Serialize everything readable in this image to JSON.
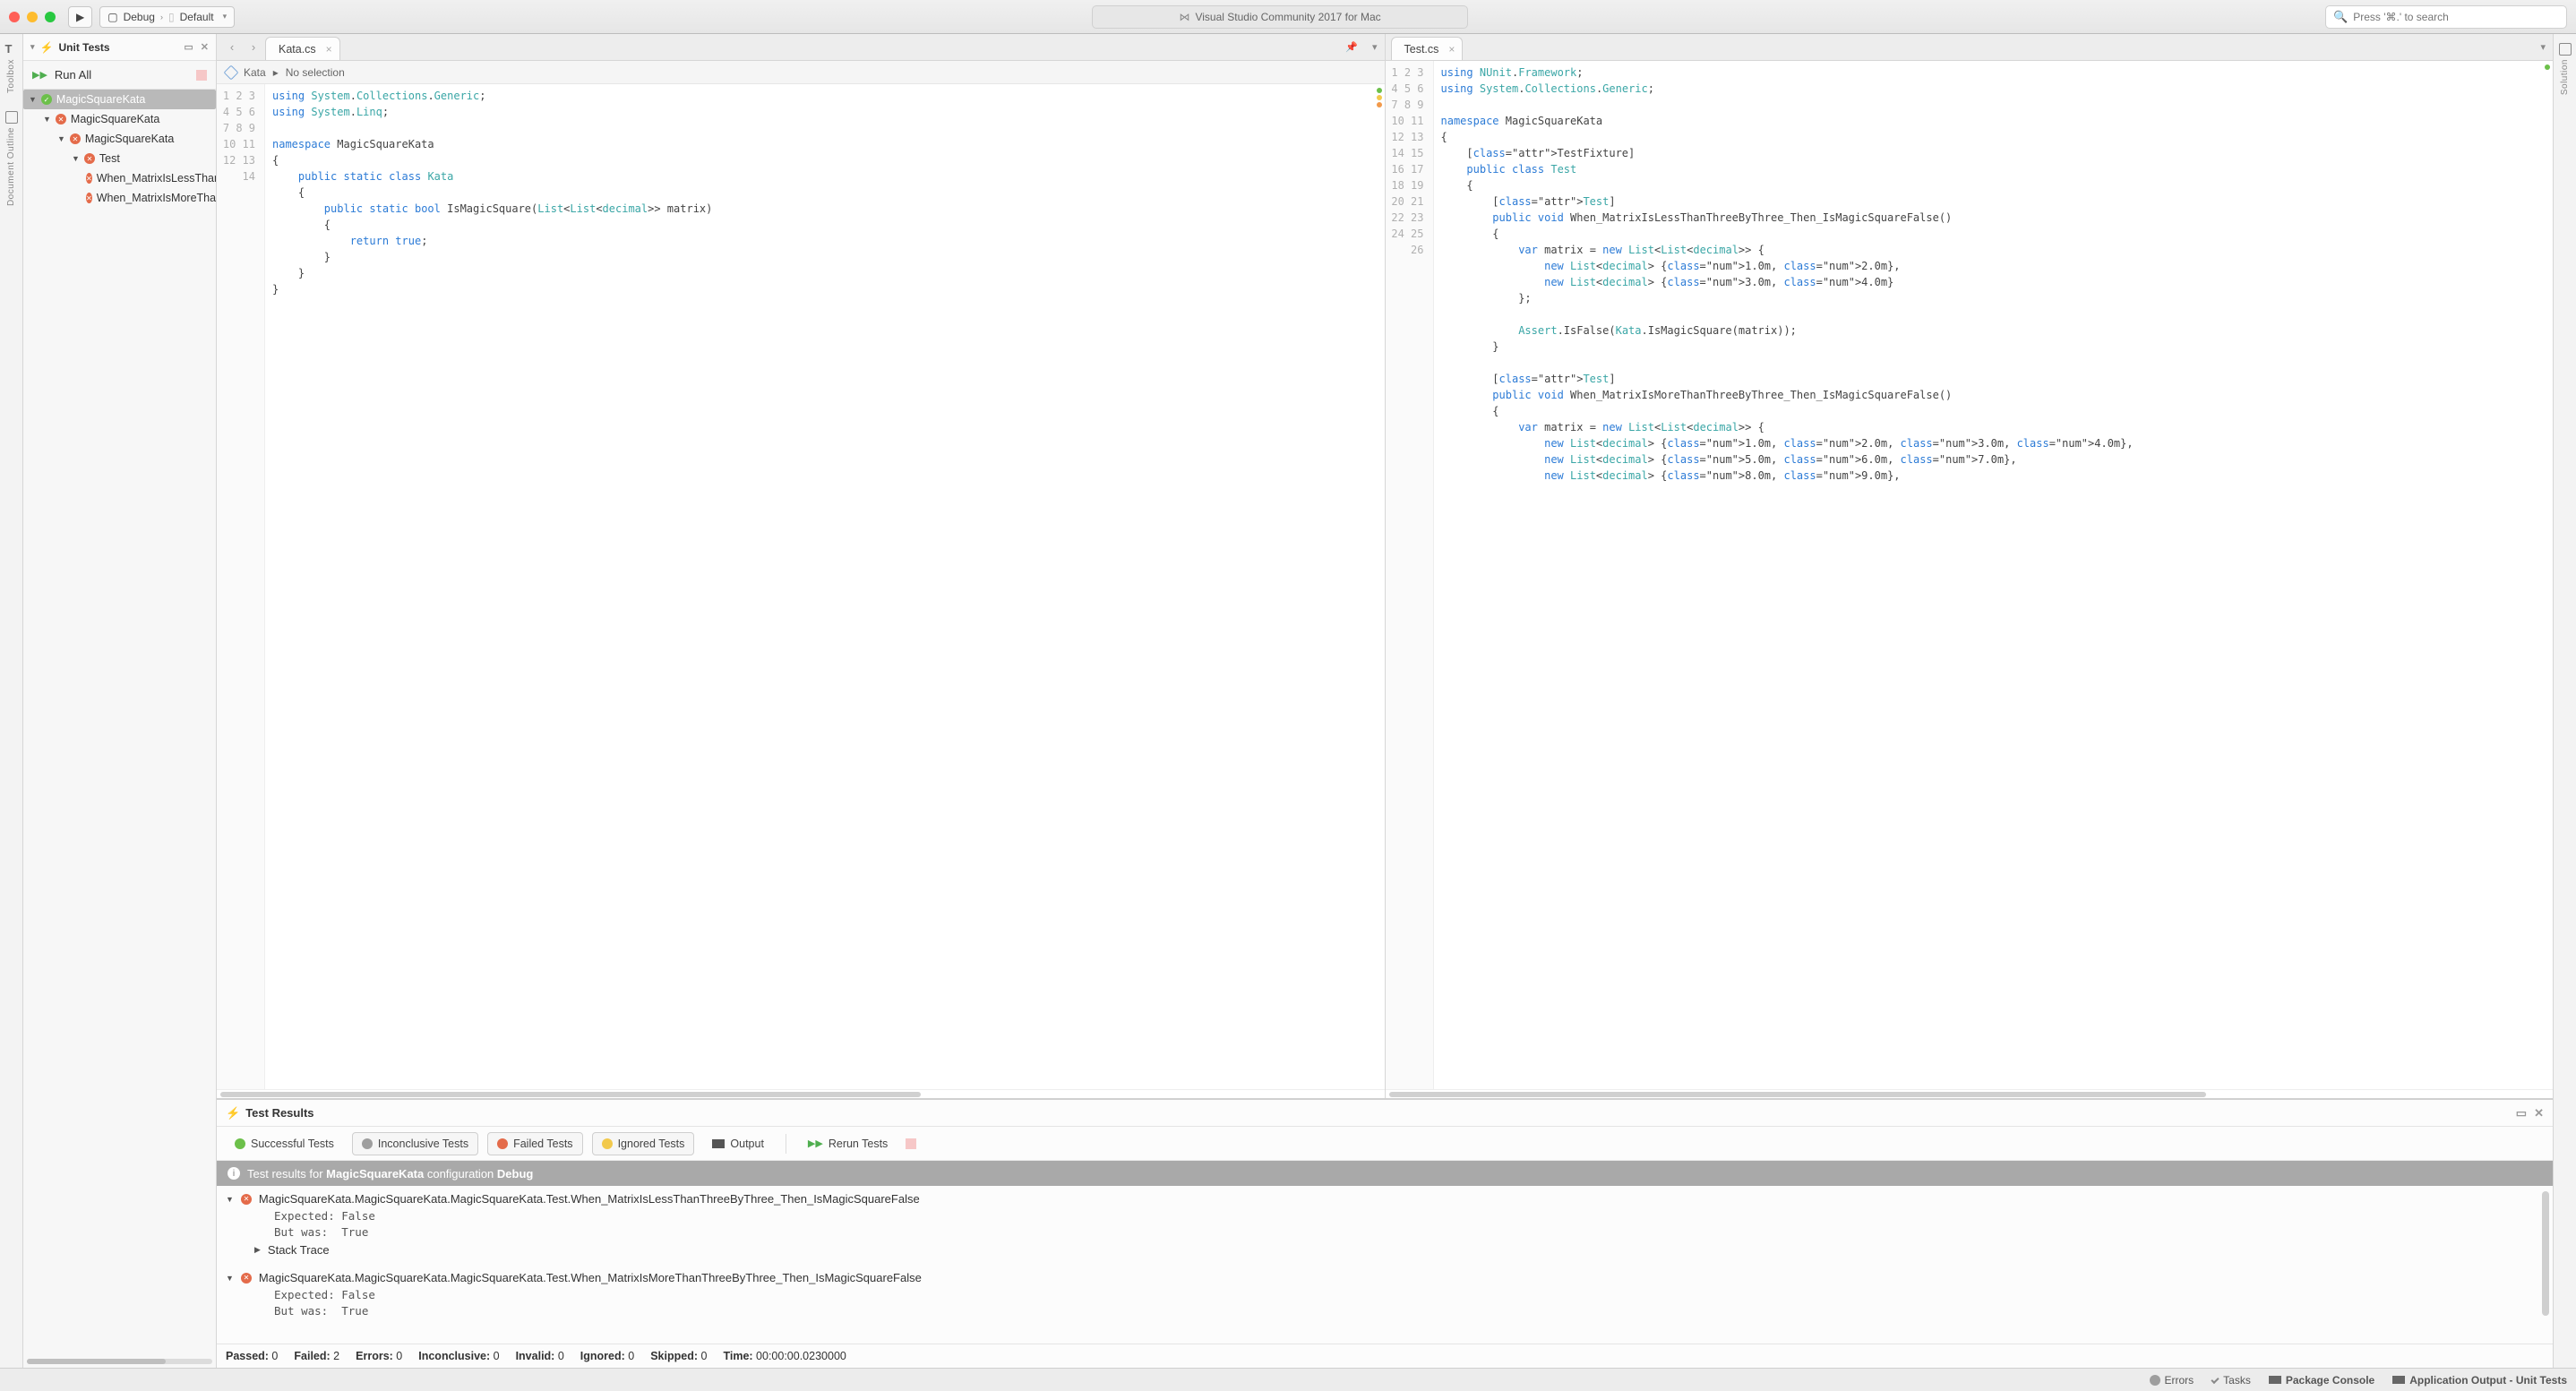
{
  "window": {
    "title": "Visual Studio Community 2017 for Mac",
    "config_selector": {
      "prefix": "Debug",
      "suffix": "Default"
    },
    "search_placeholder": "Press '⌘.' to search"
  },
  "left_rail": [
    {
      "glyph": "T",
      "label": "Toolbox"
    },
    {
      "glyph": "□",
      "label": "Document Outline"
    }
  ],
  "right_rail": [
    {
      "glyph": "□",
      "label": "Solution"
    }
  ],
  "unit_tests_panel": {
    "title": "Unit Tests",
    "run_all_label": "Run All",
    "tree": [
      {
        "depth": 0,
        "icon": "pass",
        "label": "MagicSquareKata",
        "selected": true,
        "expandable": true
      },
      {
        "depth": 1,
        "icon": "fail",
        "label": "MagicSquareKata",
        "expandable": true
      },
      {
        "depth": 2,
        "icon": "fail",
        "label": "MagicSquareKata",
        "expandable": true
      },
      {
        "depth": 3,
        "icon": "fail",
        "label": "Test",
        "expandable": true
      },
      {
        "depth": 4,
        "icon": "fail",
        "label": "When_MatrixIsLessThanThreeByThree_Then_IsMagicSquareFalse"
      },
      {
        "depth": 4,
        "icon": "fail",
        "label": "When_MatrixIsMoreThanThreeByThree_Then_IsMagicSquareFalse"
      }
    ]
  },
  "editors": {
    "left": {
      "tab": "Kata.cs",
      "breadcrumb": {
        "root": "Kata",
        "current": "No selection"
      },
      "lines": [
        "using System.Collections.Generic;",
        "using System.Linq;",
        "",
        "namespace MagicSquareKata",
        "{",
        "    public static class Kata",
        "    {",
        "        public static bool IsMagicSquare(List<List<decimal>> matrix)",
        "        {",
        "            return true;",
        "        }",
        "    }",
        "}",
        ""
      ],
      "markers": [
        "green",
        "yellow",
        "orange"
      ]
    },
    "right": {
      "tab": "Test.cs",
      "lines": [
        "using NUnit.Framework;",
        "using System.Collections.Generic;",
        "",
        "namespace MagicSquareKata",
        "{",
        "    [TestFixture]",
        "    public class Test",
        "    {",
        "        [Test]",
        "        public void When_MatrixIsLessThanThreeByThree_Then_IsMagicSquareFalse()",
        "        {",
        "            var matrix = new List<List<decimal>> {",
        "                new List<decimal> {1.0m, 2.0m},",
        "                new List<decimal> {3.0m, 4.0m}",
        "            };",
        "",
        "            Assert.IsFalse(Kata.IsMagicSquare(matrix));",
        "        }",
        "",
        "        [Test]",
        "        public void When_MatrixIsMoreThanThreeByThree_Then_IsMagicSquareFalse()",
        "        {",
        "            var matrix = new List<List<decimal>> {",
        "                new List<decimal> {1.0m, 2.0m, 3.0m, 4.0m},",
        "                new List<decimal> {5.0m, 6.0m, 7.0m},",
        "                new List<decimal> {8.0m, 9.0m},"
      ],
      "markers": [
        "green"
      ]
    }
  },
  "test_results": {
    "title": "Test Results",
    "filters": {
      "successful": "Successful Tests",
      "inconclusive": "Inconclusive Tests",
      "failed": "Failed Tests",
      "ignored": "Ignored Tests",
      "output": "Output",
      "rerun": "Rerun Tests"
    },
    "banner_prefix": "Test results for ",
    "banner_project": "MagicSquareKata",
    "banner_mid": " configuration ",
    "banner_config": "Debug",
    "failures": [
      {
        "name": "MagicSquareKata.MagicSquareKata.MagicSquareKata.Test.When_MatrixIsLessThanThreeByThree_Then_IsMagicSquareFalse",
        "expected": "False",
        "but_was": "True",
        "stack_trace_label": "Stack Trace"
      },
      {
        "name": "MagicSquareKata.MagicSquareKata.MagicSquareKata.Test.When_MatrixIsMoreThanThreeByThree_Then_IsMagicSquareFalse",
        "expected": "False",
        "but_was": "True"
      }
    ],
    "summary": {
      "passed": 0,
      "failed": 2,
      "errors": 0,
      "inconclusive": 0,
      "invalid": 0,
      "ignored": 0,
      "skipped": 0,
      "time": "00:00:00.0230000"
    },
    "summary_labels": {
      "passed": "Passed:",
      "failed": "Failed:",
      "errors": "Errors:",
      "inconclusive": "Inconclusive:",
      "invalid": "Invalid:",
      "ignored": "Ignored:",
      "skipped": "Skipped:",
      "time": "Time:"
    }
  },
  "statusbar": {
    "errors": "Errors",
    "tasks": "Tasks",
    "package_console": "Package Console",
    "app_output": "Application Output - Unit Tests"
  }
}
